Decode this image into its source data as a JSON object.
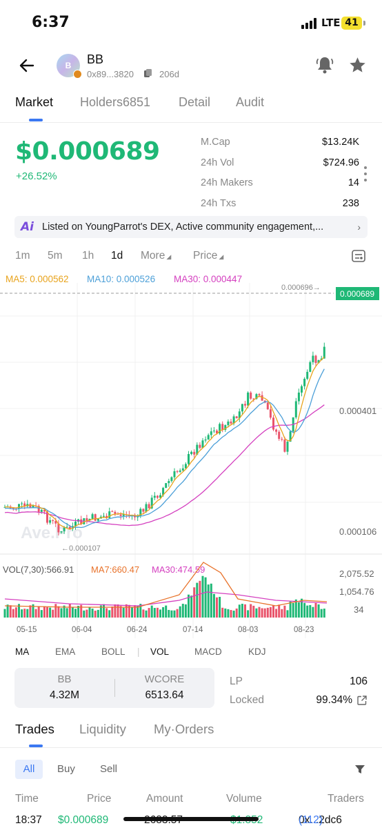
{
  "status_bar": {
    "time": "6:37",
    "network": "LTE",
    "battery": "41"
  },
  "header": {
    "token_name": "BB",
    "avatar_letter": "B",
    "address": "0x89...3820",
    "age": "206d"
  },
  "tabs": [
    "Market",
    "Holders6851",
    "Detail",
    "Audit"
  ],
  "price": {
    "value": "$0.000689",
    "change": "+26.52%"
  },
  "stats": [
    {
      "label": "M.Cap",
      "value": "$13.24K"
    },
    {
      "label": "24h Vol",
      "value": "$724.96"
    },
    {
      "label": "24h Makers",
      "value": "14"
    },
    {
      "label": "24h Txs",
      "value": "238"
    }
  ],
  "ai_banner": {
    "icon": "Ai",
    "text": "Listed on YoungParrot's DEX, Active community engagement,..."
  },
  "intervals": [
    "1m",
    "5m",
    "1h",
    "1d",
    "More",
    "Price"
  ],
  "selected_interval": "1d",
  "chart_legend": {
    "ma5": "MA5: 0.000562",
    "ma10": "MA10: 0.000526",
    "ma30": "MA30: 0.000447"
  },
  "chart_labels": {
    "high_marker": "0.000696→",
    "current_price": "0.000689",
    "y_mid": "0.000401",
    "y_low": "0.000106",
    "low_marker": "←0.000107",
    "watermark": "Ave.Pro",
    "vol_legend": "VOL(7,30):566.91",
    "vol_ma7": "MA7:660.47",
    "vol_ma30": "MA30:474.59",
    "vol_y_top": "2,075.52",
    "vol_y_mid": "1,054.76",
    "vol_y_low": "34",
    "dates": [
      "05-15",
      "06-04",
      "06-24",
      "07-14",
      "08-03",
      "08-23"
    ]
  },
  "colors": {
    "up": "#1fb876",
    "down": "#e9546b",
    "ma5": "#e8a31c",
    "ma10": "#4b9fd8",
    "ma30": "#d43fbf",
    "accent": "#3b78f2"
  },
  "indicators": [
    "MA",
    "EMA",
    "BOLL",
    "VOL",
    "MACD",
    "KDJ"
  ],
  "pool": {
    "token_a": "BB",
    "amount_a": "4.32M",
    "token_b": "WCORE",
    "amount_b": "6513.64",
    "lp_label": "LP",
    "lp_value": "106",
    "locked_label": "Locked",
    "locked_value": "99.34%"
  },
  "trade_tabs": [
    "Trades",
    "Liquidity",
    "My·Orders"
  ],
  "filters": [
    "All",
    "Buy",
    "Sell"
  ],
  "trade_columns": [
    "Time",
    "Price",
    "Amount",
    "Volume",
    "Traders"
  ],
  "trade_row": {
    "time": "18:37",
    "price": "$0.000689",
    "amount": "2683.57",
    "volume": "$1.852",
    "trader": "0x...2dc6",
    "trader_count": "(112)"
  }
}
